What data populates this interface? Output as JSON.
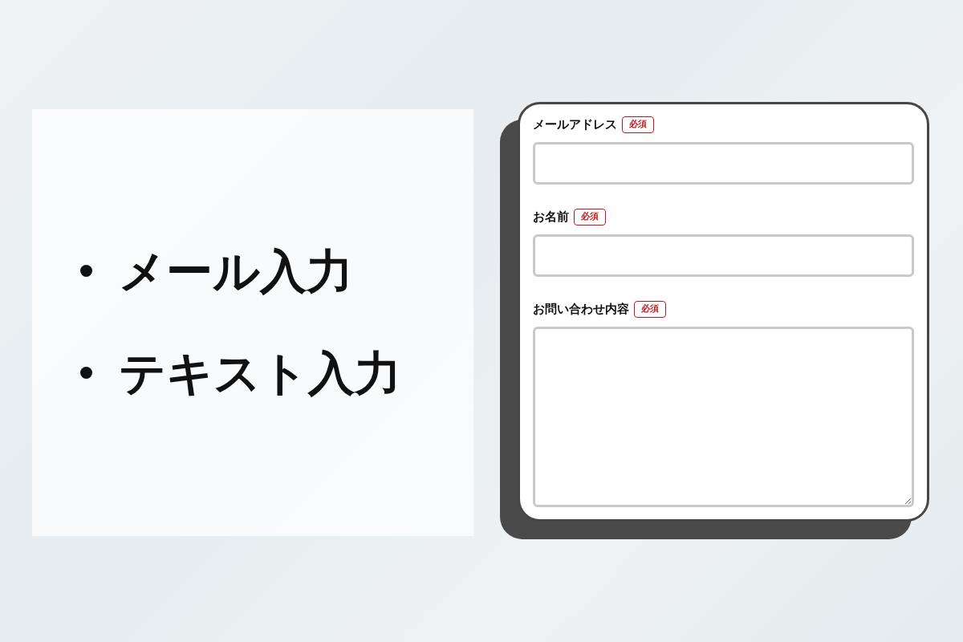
{
  "points": [
    {
      "text": "メール入力"
    },
    {
      "text": "テキスト入力"
    }
  ],
  "form": {
    "fields": [
      {
        "kind": "input",
        "label": "メールアドレス",
        "badge": "必須"
      },
      {
        "kind": "input",
        "label": "お名前",
        "badge": "必須"
      },
      {
        "kind": "textarea",
        "label": "お問い合わせ内容",
        "badge": "必須"
      }
    ]
  }
}
